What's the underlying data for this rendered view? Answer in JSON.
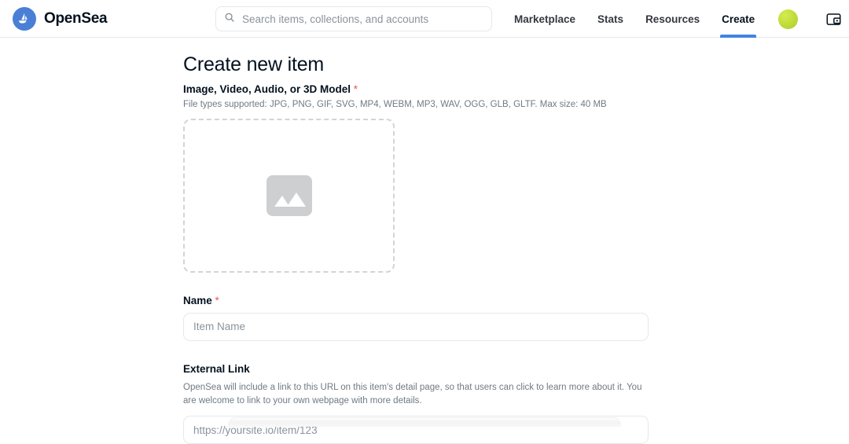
{
  "header": {
    "brand_name": "OpenSea",
    "logo_icon": "opensea-sailboat-icon",
    "search": {
      "placeholder": "Search items, collections, and accounts",
      "value": "",
      "icon": "search-icon"
    },
    "nav_items": [
      {
        "label": "Marketplace",
        "active": false
      },
      {
        "label": "Stats",
        "active": false
      },
      {
        "label": "Resources",
        "active": false
      },
      {
        "label": "Create",
        "active": true
      }
    ],
    "avatar": "user-avatar",
    "wallet_icon": "wallet-icon",
    "accent_color": "#4184e4",
    "logo_color": "#4a7fd6"
  },
  "main": {
    "page_title": "Create new item",
    "media": {
      "label": "Image, Video, Audio, or 3D Model",
      "required_marker": "*",
      "help_text": "File types supported: JPG, PNG, GIF, SVG, MP4, WEBM, MP3, WAV, OGG, GLB, GLTF. Max size: 40 MB",
      "placeholder_icon": "image-placeholder-icon"
    },
    "name": {
      "label": "Name",
      "required_marker": "*",
      "placeholder": "Item Name",
      "value": ""
    },
    "external_link": {
      "label": "External Link",
      "description": "OpenSea will include a link to this URL on this item's detail page, so that users can click to learn more about it. You are welcome to link to your own webpage with more details.",
      "placeholder": "https://yoursite.io/item/123",
      "value": ""
    }
  },
  "colors": {
    "required_red": "#eb5757",
    "muted_text": "#707a83",
    "border": "#e5e8eb"
  }
}
